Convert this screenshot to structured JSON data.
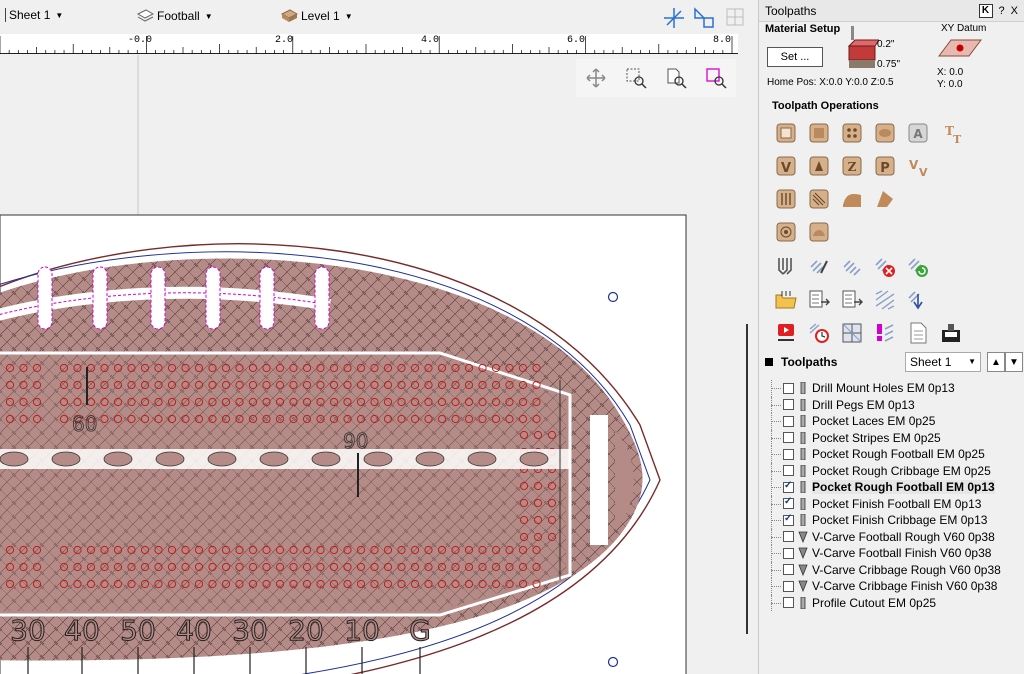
{
  "layerbar": {
    "sheet": "Sheet 1",
    "model": "Football",
    "level": "Level 1"
  },
  "ruler": {
    "labels": [
      "-0.0",
      "2.0",
      "4.0",
      "6.0",
      "8.0"
    ]
  },
  "canvas": {
    "field_labels_bottom": [
      "30",
      "40",
      "50",
      "40",
      "30",
      "20",
      "10",
      "G"
    ],
    "label_60": "60",
    "label_90": "90",
    "colors": {
      "fill": "#b58b87",
      "outline_dark": "#7a2a2a",
      "toolpath_blue": "#1f2f9a",
      "toolpath_magenta": "#d100d1",
      "peg_red": "#c21c1c",
      "background": "#ffffff"
    }
  },
  "panel": {
    "title": "Toolpaths",
    "title_buttons": [
      "?",
      "X"
    ],
    "material": {
      "title": "Material Setup",
      "set_button": "Set ...",
      "thickness_top": "0.2\"",
      "thickness_bottom": "0.75\"",
      "home_pos": "Home Pos:  X:0.0 Y:0.0 Z:0.5",
      "xy_datum_label": "XY Datum",
      "datum_x": "X: 0.0",
      "datum_y": "Y: 0.0"
    },
    "operations_title": "Toolpath Operations",
    "toolpaths_header": "Toolpaths",
    "sheet_select": "Sheet 1",
    "toolpaths": [
      {
        "label": "Drill Mount Holes EM 0p13",
        "checked": false,
        "tool": "em"
      },
      {
        "label": "Drill Pegs EM 0p13",
        "checked": false,
        "tool": "em"
      },
      {
        "label": "Pocket Laces EM 0p25",
        "checked": false,
        "tool": "em"
      },
      {
        "label": "Pocket Stripes EM 0p25",
        "checked": false,
        "tool": "em"
      },
      {
        "label": "Pocket Rough Football EM 0p25",
        "checked": false,
        "tool": "em"
      },
      {
        "label": "Pocket Rough Cribbage EM 0p25",
        "checked": false,
        "tool": "em"
      },
      {
        "label": "Pocket Rough Football EM 0p13",
        "checked": true,
        "tool": "em",
        "selected": true
      },
      {
        "label": "Pocket Finish Football EM 0p13",
        "checked": true,
        "tool": "em"
      },
      {
        "label": "Pocket Finish Cribbage EM 0p13",
        "checked": true,
        "tool": "em"
      },
      {
        "label": "V-Carve Football Rough V60 0p38",
        "checked": false,
        "tool": "v"
      },
      {
        "label": "V-Carve Football Finish V60 0p38",
        "checked": false,
        "tool": "v"
      },
      {
        "label": "V-Carve Cribbage Rough V60 0p38",
        "checked": false,
        "tool": "v"
      },
      {
        "label": "V-Carve Cribbage Finish V60 0p38",
        "checked": false,
        "tool": "v"
      },
      {
        "label": "Profile Cutout EM 0p25",
        "checked": false,
        "tool": "em"
      }
    ]
  }
}
